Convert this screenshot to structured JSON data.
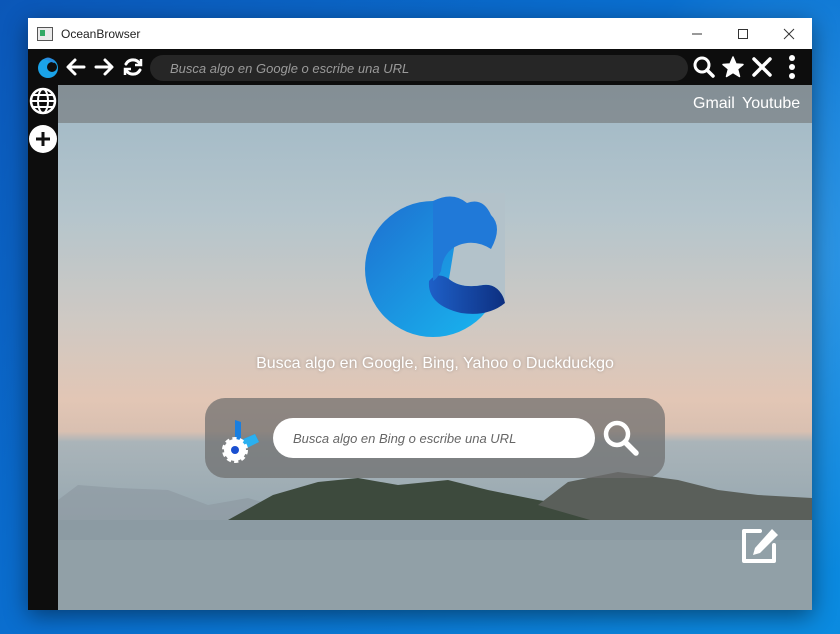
{
  "window": {
    "title": "OceanBrowser",
    "controls": {
      "minimize": "—",
      "maximize": "☐",
      "close": "✕"
    }
  },
  "toolbar": {
    "url_placeholder": "Busca algo en Google o escribe una URL",
    "icons": [
      "ocean-logo-icon",
      "back-arrow-icon",
      "forward-arrow-icon",
      "reload-icon",
      "search-icon",
      "star-icon",
      "close-icon",
      "more-vertical-icon"
    ]
  },
  "sidebar": {
    "icons": [
      "globe-icon",
      "plus-icon"
    ]
  },
  "topnav": {
    "links": [
      {
        "label": "Gmail"
      },
      {
        "label": "Youtube"
      }
    ]
  },
  "home": {
    "tagline": "Busca algo en Google, Bing, Yahoo o Duckduckgo",
    "search_placeholder": "Busca algo en Bing o escribe una URL",
    "engine_icon": "bing-settings-icon",
    "search_icon": "magnifier-icon",
    "edit_icon": "edit-icon"
  },
  "colors": {
    "desktop": "#0a6fd0",
    "toolbar": "#0d0d0d",
    "urlbar": "#262626",
    "accent_blue": "#1aa3e8"
  }
}
